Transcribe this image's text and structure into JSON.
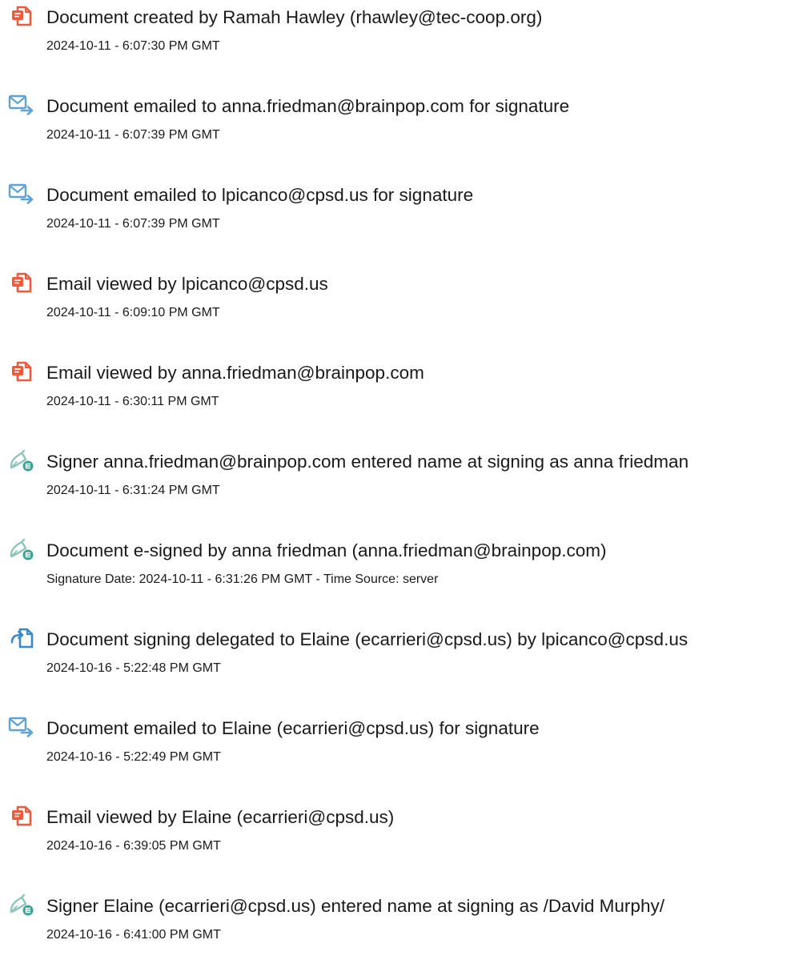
{
  "colors": {
    "doc_icon": "#EE5A3A",
    "email_icon": "#5FA3D6",
    "sign_icon": "#3AA397",
    "delegate_icon": "#3A88CC",
    "text": "#1A1A1A"
  },
  "events": [
    {
      "icon": "document-icon",
      "title": "Document created by Ramah Hawley (rhawley@tec-coop.org)",
      "time": "2024-10-11 - 6:07:30 PM GMT"
    },
    {
      "icon": "email-sent-icon",
      "title": "Document emailed to anna.friedman@brainpop.com for signature",
      "time": "2024-10-11 - 6:07:39 PM GMT"
    },
    {
      "icon": "email-sent-icon",
      "title": "Document emailed to lpicanco@cpsd.us for signature",
      "time": "2024-10-11 - 6:07:39 PM GMT"
    },
    {
      "icon": "document-icon",
      "title": "Email viewed by lpicanco@cpsd.us",
      "time": "2024-10-11 - 6:09:10 PM GMT"
    },
    {
      "icon": "document-icon",
      "title": "Email viewed by anna.friedman@brainpop.com",
      "time": "2024-10-11 - 6:30:11 PM GMT"
    },
    {
      "icon": "esign-pen-icon",
      "title": "Signer anna.friedman@brainpop.com entered name at signing as anna friedman",
      "time": "2024-10-11 - 6:31:24 PM GMT"
    },
    {
      "icon": "esign-pen-icon",
      "title": "Document e-signed by anna friedman (anna.friedman@brainpop.com)",
      "time": "Signature Date: 2024-10-11 - 6:31:26 PM GMT - Time Source: server"
    },
    {
      "icon": "delegate-icon",
      "title": "Document signing delegated to Elaine (ecarrieri@cpsd.us) by lpicanco@cpsd.us",
      "time": "2024-10-16 - 5:22:48 PM GMT"
    },
    {
      "icon": "email-sent-icon",
      "title": "Document emailed to Elaine (ecarrieri@cpsd.us) for signature",
      "time": "2024-10-16 - 5:22:49 PM GMT"
    },
    {
      "icon": "document-icon",
      "title": "Email viewed by Elaine (ecarrieri@cpsd.us)",
      "time": "2024-10-16 - 6:39:05 PM GMT"
    },
    {
      "icon": "esign-pen-icon",
      "title": "Signer Elaine (ecarrieri@cpsd.us) entered name at signing as /David Murphy/",
      "time": "2024-10-16 - 6:41:00 PM GMT"
    }
  ]
}
